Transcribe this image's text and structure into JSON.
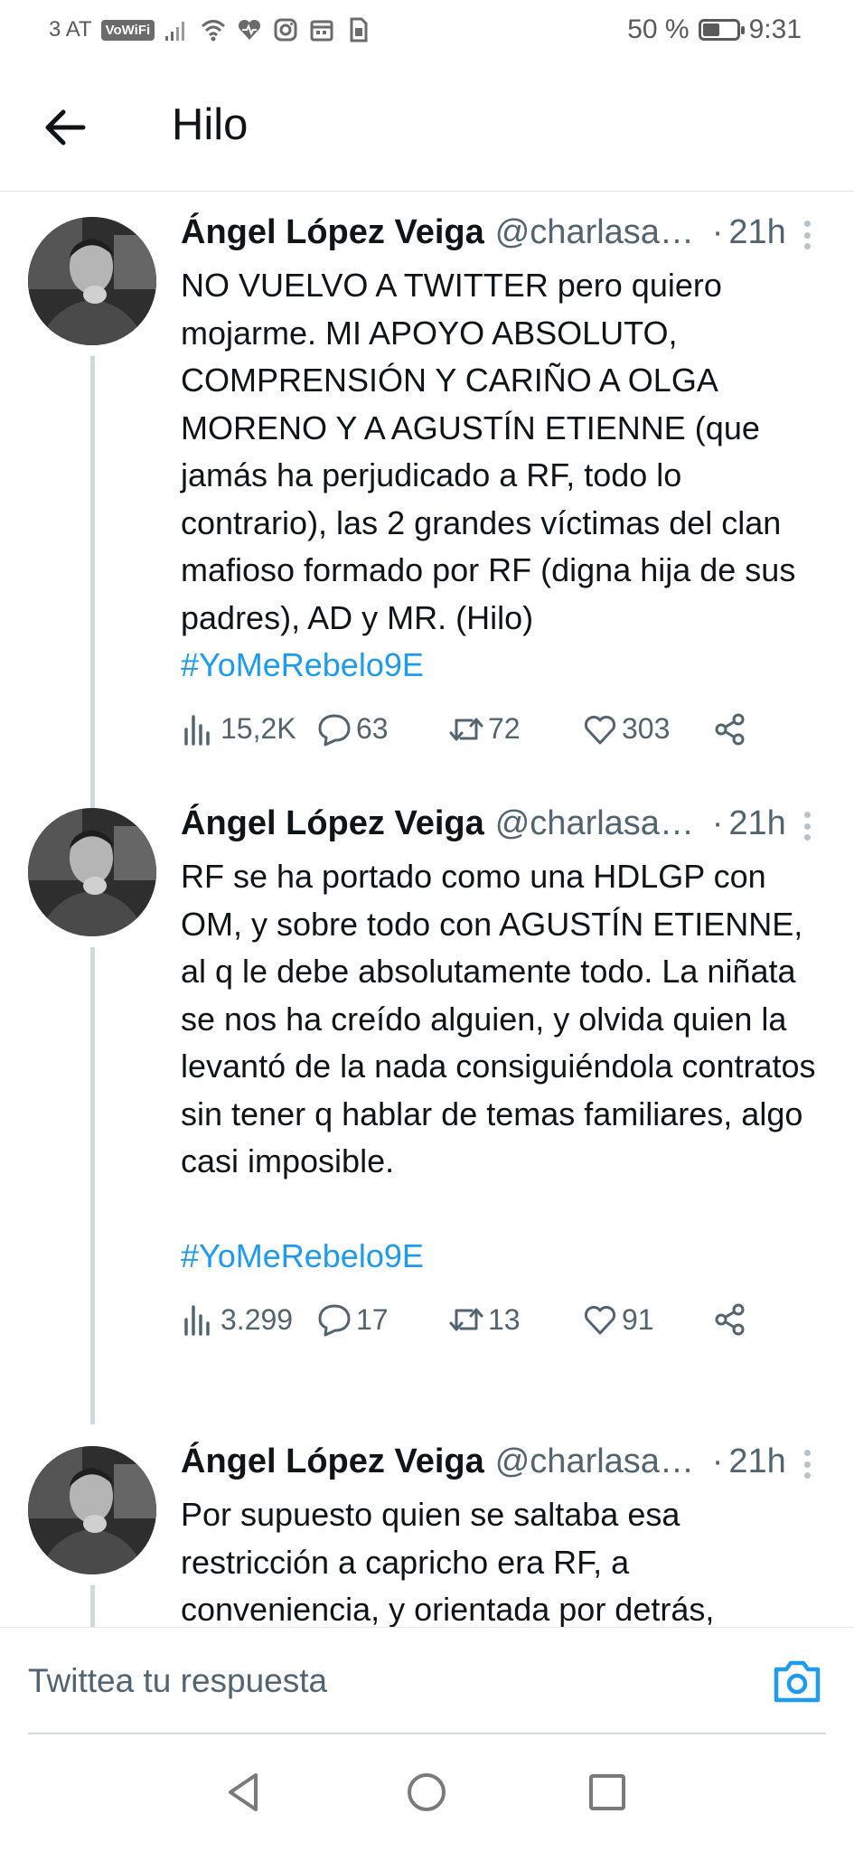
{
  "status_bar": {
    "carrier": "3 AT",
    "vowifi": "VoWiFi",
    "battery_percent": "50 %",
    "battery_level": 0.5,
    "time": "9:31"
  },
  "header": {
    "back_icon": "arrow-left-icon",
    "title": "Hilo"
  },
  "tweets": [
    {
      "name": "Ángel López Veiga",
      "handle": "@charlasal...",
      "separator": "·",
      "time": "21h",
      "text": "NO VUELVO A TWITTER pero quiero mojarme. MI APOYO ABSOLUTO, COMPRENSIÓN Y CARIÑO A OLGA MORENO Y A AGUSTÍN ETIENNE (que jamás ha perjudicado a RF, todo lo contrario), las 2 grandes víctimas del clan mafioso formado por RF (digna hija de sus padres), AD y MR. (Hilo)",
      "hashtag": "#YoMeRebelo9E",
      "views": "15,2K",
      "replies": "63",
      "retweets": "72",
      "likes": "303"
    },
    {
      "name": "Ángel López Veiga",
      "handle": "@charlasal...",
      "separator": "·",
      "time": "21h",
      "text": "RF se ha portado como una HDLGP con OM, y sobre todo con AGUSTÍN ETIENNE, al q le debe absolutamente todo. La niñata se nos ha creído alguien, y olvida quien la levantó de la nada consiguiéndola contratos sin tener q hablar de temas familiares, algo casi imposible.",
      "hashtag": "#YoMeRebelo9E",
      "views": "3.299",
      "replies": "17",
      "retweets": "13",
      "likes": "91"
    },
    {
      "name": "Ángel López Veiga",
      "handle": "@charlasal...",
      "separator": "·",
      "time": "21h",
      "text": "Por supuesto quien se saltaba esa restricción a capricho era RF, a conveniencia, y orientada por detrás,"
    }
  ],
  "reply_bar": {
    "placeholder": "Twittea tu respuesta",
    "camera_icon": "camera-icon"
  },
  "colors": {
    "accent": "#1d9bf0",
    "text": "#0f1419",
    "muted": "#536471",
    "thread_line": "#cfd9de"
  }
}
